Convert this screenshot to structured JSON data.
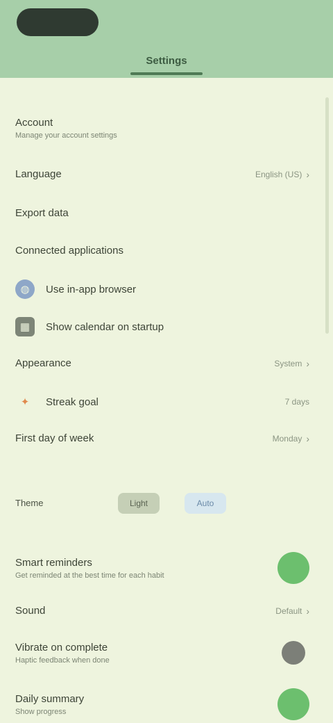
{
  "header": {
    "status": "",
    "right_text": "",
    "tabs": [
      {
        "label": ""
      },
      {
        "label": "Settings"
      },
      {
        "label": ""
      }
    ]
  },
  "settings": {
    "account": {
      "label": "Account",
      "sub": "Manage your account settings"
    },
    "language": {
      "label": "Language",
      "value": "English (US)"
    },
    "export_data": {
      "label": "Export data"
    },
    "connected": {
      "label": "Connected applications"
    },
    "browser": {
      "label": "Use in-app browser"
    },
    "calendar": {
      "label": "Show calendar on startup"
    },
    "appearance": {
      "label": "Appearance",
      "value": "System"
    },
    "streak": {
      "label": "Streak goal",
      "value": "7 days"
    },
    "first_day": {
      "label": "First day of week",
      "value": "Monday"
    },
    "theme": {
      "label": "Theme",
      "option_a": "Light",
      "option_b": "Auto"
    },
    "smart_reminders": {
      "label": "Smart reminders",
      "sub": "Get reminded at the best time for each habit"
    },
    "sound": {
      "label": "Sound",
      "value": "Default"
    },
    "vibrate": {
      "label": "Vibrate on complete",
      "sub": "Haptic feedback when done"
    },
    "daily_summary": {
      "label": "Daily summary",
      "sub": "Show progress"
    }
  },
  "icons": {
    "globe": "globe-icon",
    "calendar": "calendar-icon",
    "streak": "fire-icon"
  },
  "colors": {
    "header": "#a7cfa9",
    "background": "#eef4de",
    "toggle_on": "#6cbf6e",
    "toggle_off": "#7c7f78"
  },
  "toggles": {
    "smart_reminders": true,
    "vibrate": false,
    "daily_summary": true
  }
}
